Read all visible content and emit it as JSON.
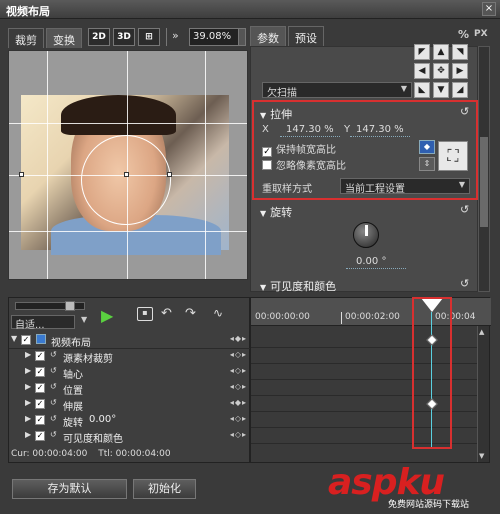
{
  "window": {
    "title": "视频布局",
    "close": "×"
  },
  "left_tabs": [
    "裁剪",
    "变换"
  ],
  "toolbar": {
    "btn_2d": "2D",
    "btn_3d": "3D",
    "zoom": "39.08%"
  },
  "right_tabs": [
    "参数",
    "预设"
  ],
  "unit_icons": {
    "percent": "%",
    "px": "PX"
  },
  "scan_select": "欠扫描",
  "stretch": {
    "title": "拉伸",
    "x_label": "X",
    "x_value": "147.30 %",
    "y_label": "Y",
    "y_value": "147.30 %",
    "keep_ratio": "保持帧宽高比",
    "ignore_pixel": "忽略像素宽高比",
    "resample_label": "重取样方式",
    "resample_value": "当前工程设置"
  },
  "rotate": {
    "title": "旋转",
    "value": "0.00 °"
  },
  "visibility": {
    "title": "可见度和颜色"
  },
  "tracks": {
    "auto_label": "自适...",
    "root": "视频布局",
    "items": [
      "源素材裁剪",
      "轴心",
      "位置",
      "伸展",
      "旋转",
      "可见度和颜色"
    ],
    "rotate_val": "0.00°"
  },
  "status": {
    "cur": "Cur: 00:00:04:00",
    "ttl": "Ttl: 00:00:04:00"
  },
  "timecodes": [
    "00:00:00:00",
    "00:00:02:00",
    "00:00:04"
  ],
  "buttons": {
    "save_default": "存为默认",
    "init": "初始化"
  },
  "watermark": {
    "main": "aspku",
    "sub": "免费网站源码下载站"
  }
}
